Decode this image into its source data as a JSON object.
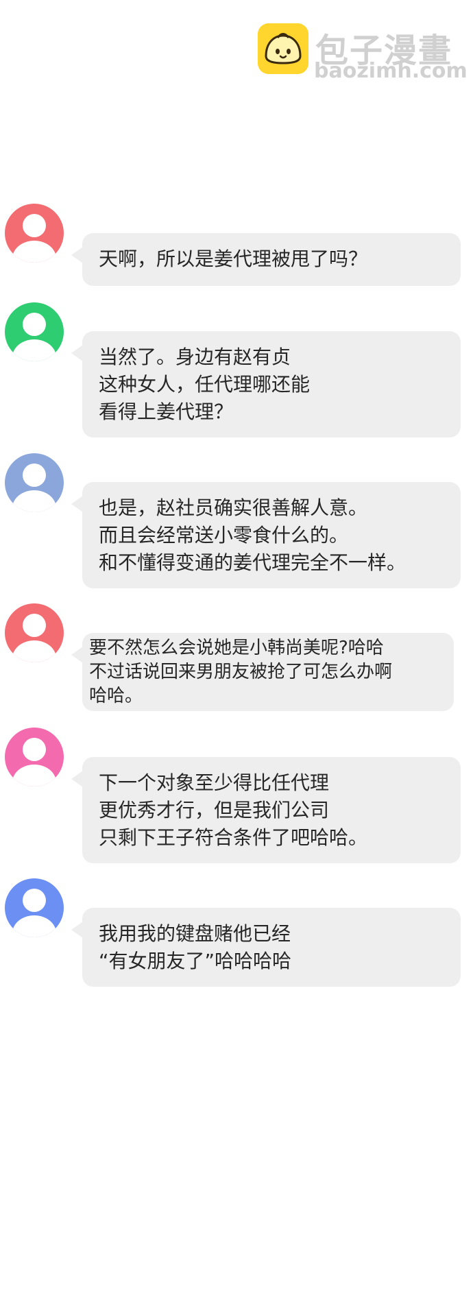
{
  "watermark": {
    "site_name": "包子漫畫",
    "url": "baozimh.com",
    "logo_icon": "bun-mascot-icon",
    "logo_color": "#ffd52e"
  },
  "messages": [
    {
      "avatar_color": "#f26c72",
      "text": "天啊，所以是姜代理被甩了吗？"
    },
    {
      "avatar_color": "#2fcd71",
      "text": "当然了。身边有赵有贞\n这种女人，任代理哪还能\n看得上姜代理？"
    },
    {
      "avatar_color": "#8aa6db",
      "text": "也是，赵社员确实很善解人意。\n而且会经常送小零食什么的。\n和不懂得变通的姜代理完全不一样。"
    },
    {
      "avatar_color": "#f26c72",
      "text": "要不然怎么会说她是小韩尚美呢?哈哈\n不过话说回来男朋友被抢了可怎么办啊\n哈哈。"
    },
    {
      "avatar_color": "#f46aaf",
      "text": "下一个对象至少得比任代理\n更优秀才行，但是我们公司\n只剩下王子符合条件了吧哈哈。"
    },
    {
      "avatar_color": "#6b8ff2",
      "text": "我用我的键盘赌他已经\n“有女朋友了”哈哈哈哈"
    }
  ]
}
